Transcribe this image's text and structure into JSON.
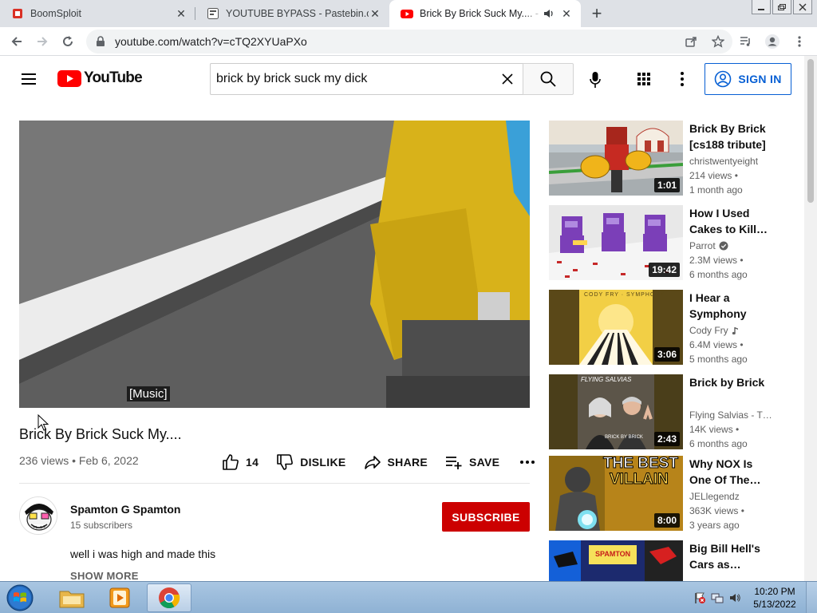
{
  "browser": {
    "tabs": [
      {
        "title": "BoomSploit",
        "icon": "boomsploit-icon"
      },
      {
        "title": "YOUTUBE BYPASS - Pastebin.com",
        "icon": "pastebin-icon"
      },
      {
        "title": "Brick By Brick Suck My.... - YouTube",
        "icon": "youtube-icon",
        "active": true
      }
    ],
    "url": "youtube.com/watch?v=cTQ2XYUaPXo"
  },
  "header": {
    "logo_text": "YouTube",
    "search_value": "brick by brick suck my dick",
    "signin_label": "SIGN IN"
  },
  "video": {
    "caption": "[Music]",
    "title": "Brick By Brick Suck My....",
    "meta": "236 views • Feb 6, 2022",
    "likes": "14",
    "dislike_label": "DISLIKE",
    "share_label": "SHARE",
    "save_label": "SAVE"
  },
  "channel": {
    "name": "Spamton G Spamton",
    "subscribers": "15 subscribers",
    "subscribe_label": "SUBSCRIBE",
    "description": "well i was high and made this",
    "show_more": "SHOW MORE"
  },
  "recommendations": [
    {
      "title": "Brick By Brick [cs188 tribute]",
      "channel": "christwentyeight",
      "views": "214 views •",
      "ago": "1 month ago",
      "duration": "1:01"
    },
    {
      "title": "How I Used Cakes to Kill…",
      "channel": "Parrot",
      "verified": true,
      "views": "2.3M views •",
      "ago": "6 months ago",
      "duration": "19:42"
    },
    {
      "title": "I Hear a Symphony",
      "channel": "Cody Fry",
      "music": true,
      "views": "6.4M views •",
      "ago": "5 months ago",
      "duration": "3:06"
    },
    {
      "title": "Brick by Brick",
      "channel": "Flying Salvias - T…",
      "views": "14K views •",
      "ago": "6 months ago",
      "duration": "2:43"
    },
    {
      "title": "Why NOX Is One Of The…",
      "channel": "JELlegendz",
      "views": "363K views •",
      "ago": "3 years ago",
      "duration": "8:00"
    },
    {
      "title": "Big Bill Hell's Cars as…",
      "channel": "",
      "views": "",
      "ago": "",
      "duration": ""
    }
  ],
  "thumb_text": {
    "rec3_top": "CODY FRY · SYMPHONY",
    "rec4_top": "FLYING SALVIAS",
    "rec4_sub": "BRICK BY BRICK",
    "rec5_line1": "THE BEST",
    "rec5_line2": "VILLAIN",
    "rec6_sign": "SPAMTON"
  },
  "taskbar": {
    "time": "10:20 PM",
    "date": "5/13/2022"
  },
  "colors": {
    "youtube_red": "#ff0000",
    "subscribe_red": "#cc0000",
    "link_blue": "#065fd4"
  }
}
